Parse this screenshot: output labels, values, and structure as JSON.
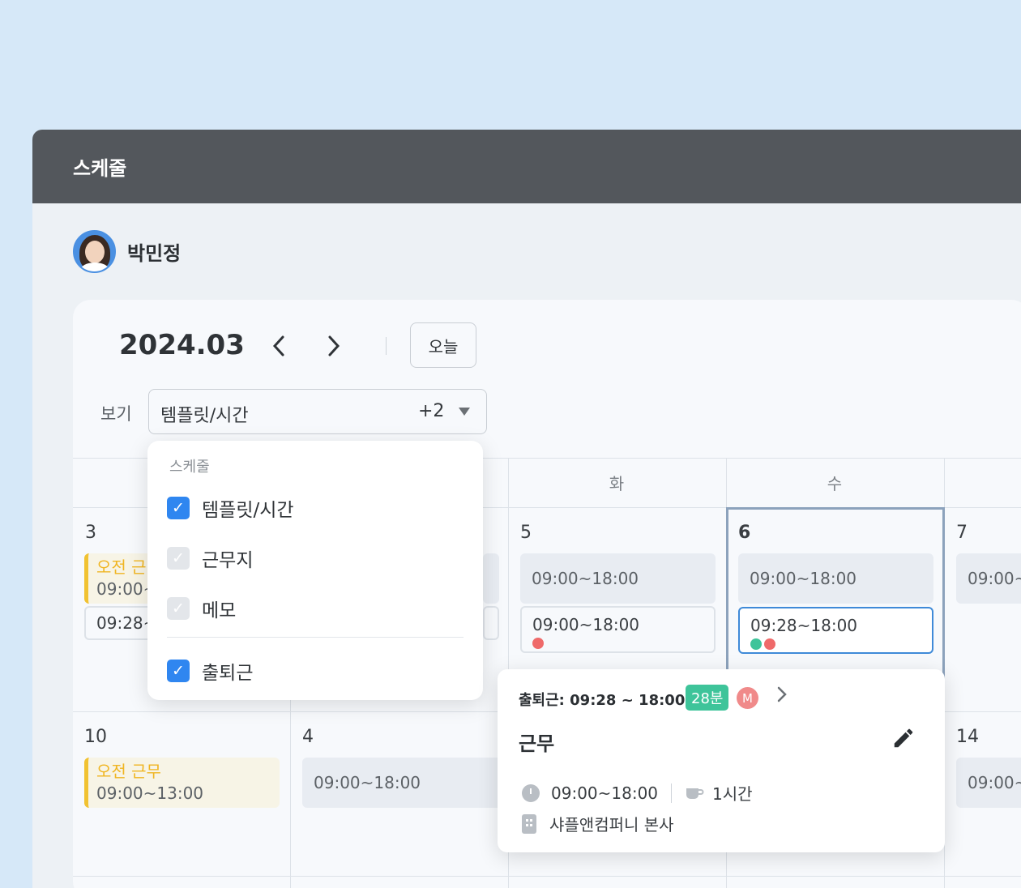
{
  "header": {
    "title": "스케줄"
  },
  "user": {
    "name": "박민정"
  },
  "calendar": {
    "month": "2024.03",
    "today_label": "오늘",
    "view_label": "보기",
    "view_value": "템플릿/시간",
    "view_extra": "+2",
    "day_names": [
      "화",
      "수"
    ],
    "days": {
      "d3": "3",
      "d5": "5",
      "d6": "6",
      "d7": "7",
      "d10": "10",
      "d4": "4",
      "d14": "14"
    },
    "cards": {
      "am_title": "오전 근무",
      "am_time": "09:00~13:00",
      "shift_time": "09:00~18:00",
      "out_time_1": "09:00~18:00",
      "out_time_2": "09:28~18:00",
      "clip_am_title": "오전 근",
      "clip_am_time": "09:00~",
      "clip_out_time": "09:28~",
      "clip_shift": "09:00~"
    }
  },
  "view_menu": {
    "section_title": "스케줄",
    "items": [
      {
        "label": "템플릿/시간",
        "checked": true
      },
      {
        "label": "근무지",
        "checked": false
      },
      {
        "label": "메모",
        "checked": false
      },
      {
        "label": "출퇴근",
        "checked": true
      }
    ]
  },
  "popover": {
    "header": "출퇴근: 09:28 ~ 18:00",
    "late_badge": "28분",
    "member_badge": "M",
    "title": "근무",
    "time": "09:00~18:00",
    "break": "1시간",
    "location": "샤플앤컴퍼니 본사"
  },
  "colors": {
    "accent": "#2f86f0",
    "late_badge": "#3ec49a",
    "alert_dot": "#ef6a6a",
    "am_shift": "#f1c232",
    "titlebar": "#53575c"
  }
}
